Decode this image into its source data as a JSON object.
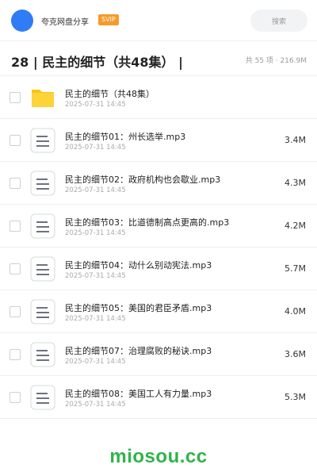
{
  "header": {
    "site_name": "夸克网盘分享",
    "badge": "SVIP",
    "search_placeholder": "搜索"
  },
  "folder": {
    "title": "28 | 民主的细节（共48集） |",
    "summary": "共 55 项 · 216.9M"
  },
  "files": [
    {
      "name": "民主的细节（共48集）",
      "date": "2025-07-31 14:45",
      "size": "",
      "type": "folder"
    },
    {
      "name": "民主的细节01：州长选举.mp3",
      "date": "2025-07-31 14:45",
      "size": "3.4M",
      "type": "file"
    },
    {
      "name": "民主的细节02：政府机构也会歇业.mp3",
      "date": "2025-07-31 14:45",
      "size": "4.3M",
      "type": "file"
    },
    {
      "name": "民主的细节03：比道德制高点更高的.mp3",
      "date": "2025-07-31 14:45",
      "size": "4.2M",
      "type": "file"
    },
    {
      "name": "民主的细节04：动什么别动宪法.mp3",
      "date": "2025-07-31 14:45",
      "size": "5.7M",
      "type": "file"
    },
    {
      "name": "民主的细节05：美国的君臣矛盾.mp3",
      "date": "2025-07-31 14:45",
      "size": "4.0M",
      "type": "file"
    },
    {
      "name": "民主的细节07：治理腐败的秘诀.mp3",
      "date": "2025-07-31 14:45",
      "size": "3.6M",
      "type": "file"
    },
    {
      "name": "民主的细节08：美国工人有力量.mp3",
      "date": "2025-07-31 14:45",
      "size": "5.3M",
      "type": "file"
    }
  ],
  "watermark": "miosou.cc",
  "colors": {
    "avatar": "#2f7cf6",
    "badge": "#f59b2a",
    "folder_icon": "#fcc40f",
    "watermark": "#2fb34a"
  }
}
